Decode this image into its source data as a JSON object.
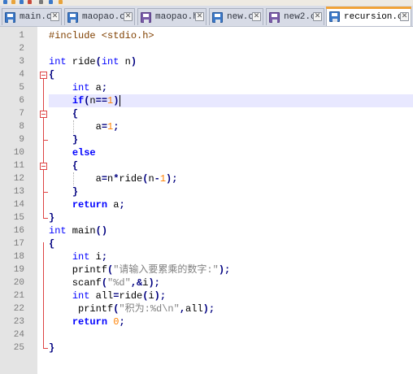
{
  "tabs": [
    {
      "label": "main.c",
      "icon": "save-icon",
      "color": "blue",
      "active": false
    },
    {
      "label": "maopao.c",
      "icon": "save-icon",
      "color": "blue",
      "active": false
    },
    {
      "label": "maopao.h",
      "icon": "save-icon",
      "color": "purple",
      "active": false
    },
    {
      "label": "new.c",
      "icon": "save-icon",
      "color": "blue",
      "active": false
    },
    {
      "label": "new2.c",
      "icon": "save-icon",
      "color": "purple",
      "active": false
    },
    {
      "label": "recursion.c",
      "icon": "save-icon",
      "color": "blue",
      "active": true
    }
  ],
  "close_symbol": "✕",
  "editor": {
    "current_line": 6,
    "lines": [
      {
        "n": "1",
        "tokens": [
          [
            "t-pre",
            "#include <stdio.h>"
          ]
        ]
      },
      {
        "n": "2",
        "tokens": []
      },
      {
        "n": "3",
        "tokens": [
          [
            "t-kw",
            "int"
          ],
          [
            "t-id",
            " ride"
          ],
          [
            "t-op",
            "("
          ],
          [
            "t-kw",
            "int"
          ],
          [
            "t-id",
            " n"
          ],
          [
            "t-op",
            ")"
          ]
        ]
      },
      {
        "n": "4",
        "tokens": [
          [
            "t-op",
            "{"
          ]
        ]
      },
      {
        "n": "5",
        "tokens": [
          [
            "t-id",
            "    "
          ],
          [
            "t-kw",
            "int"
          ],
          [
            "t-id",
            " a"
          ],
          [
            "t-op",
            ";"
          ]
        ]
      },
      {
        "n": "6",
        "tokens": [
          [
            "t-id",
            "    "
          ],
          [
            "t-kwb",
            "if"
          ],
          [
            "t-op",
            "("
          ],
          [
            "t-id",
            "n"
          ],
          [
            "t-op",
            "=="
          ],
          [
            "t-num",
            "1"
          ],
          [
            "t-op",
            ")"
          ]
        ]
      },
      {
        "n": "7",
        "tokens": [
          [
            "t-id",
            "    "
          ],
          [
            "t-op",
            "{"
          ]
        ]
      },
      {
        "n": "8",
        "tokens": [
          [
            "t-id",
            "        a"
          ],
          [
            "t-op",
            "="
          ],
          [
            "t-num",
            "1"
          ],
          [
            "t-op",
            ";"
          ]
        ]
      },
      {
        "n": "9",
        "tokens": [
          [
            "t-id",
            "    "
          ],
          [
            "t-op",
            "}"
          ]
        ]
      },
      {
        "n": "10",
        "tokens": [
          [
            "t-id",
            "    "
          ],
          [
            "t-kwb",
            "else"
          ]
        ]
      },
      {
        "n": "11",
        "tokens": [
          [
            "t-id",
            "    "
          ],
          [
            "t-op",
            "{"
          ]
        ]
      },
      {
        "n": "12",
        "tokens": [
          [
            "t-id",
            "        a"
          ],
          [
            "t-op",
            "="
          ],
          [
            "t-id",
            "n"
          ],
          [
            "t-op",
            "*"
          ],
          [
            "t-id",
            "ride"
          ],
          [
            "t-op",
            "("
          ],
          [
            "t-id",
            "n"
          ],
          [
            "t-op",
            "-"
          ],
          [
            "t-num",
            "1"
          ],
          [
            "t-op",
            ");"
          ]
        ]
      },
      {
        "n": "13",
        "tokens": [
          [
            "t-id",
            "    "
          ],
          [
            "t-op",
            "}"
          ]
        ]
      },
      {
        "n": "14",
        "tokens": [
          [
            "t-id",
            "    "
          ],
          [
            "t-kwb",
            "return"
          ],
          [
            "t-id",
            " a"
          ],
          [
            "t-op",
            ";"
          ]
        ]
      },
      {
        "n": "15",
        "tokens": [
          [
            "t-op",
            "}"
          ]
        ]
      },
      {
        "n": "16",
        "tokens": [
          [
            "t-kw",
            "int"
          ],
          [
            "t-id",
            " main"
          ],
          [
            "t-op",
            "()"
          ]
        ]
      },
      {
        "n": "17",
        "tokens": [
          [
            "t-op",
            "{"
          ]
        ]
      },
      {
        "n": "18",
        "tokens": [
          [
            "t-id",
            "    "
          ],
          [
            "t-kw",
            "int"
          ],
          [
            "t-id",
            " i"
          ],
          [
            "t-op",
            ";"
          ]
        ]
      },
      {
        "n": "19",
        "tokens": [
          [
            "t-id",
            "    printf"
          ],
          [
            "t-op",
            "("
          ],
          [
            "t-str",
            "\"请输入要累乘的数字:\""
          ],
          [
            "t-op",
            ");"
          ]
        ]
      },
      {
        "n": "20",
        "tokens": [
          [
            "t-id",
            "    scanf"
          ],
          [
            "t-op",
            "("
          ],
          [
            "t-str",
            "\"%d\""
          ],
          [
            "t-op",
            ",&"
          ],
          [
            "t-id",
            "i"
          ],
          [
            "t-op",
            ");"
          ]
        ]
      },
      {
        "n": "21",
        "tokens": [
          [
            "t-id",
            "    "
          ],
          [
            "t-kw",
            "int"
          ],
          [
            "t-id",
            " all"
          ],
          [
            "t-op",
            "="
          ],
          [
            "t-id",
            "ride"
          ],
          [
            "t-op",
            "("
          ],
          [
            "t-id",
            "i"
          ],
          [
            "t-op",
            ");"
          ]
        ]
      },
      {
        "n": "22",
        "tokens": [
          [
            "t-id",
            "     printf"
          ],
          [
            "t-op",
            "("
          ],
          [
            "t-str",
            "\"积为:%d\\n\""
          ],
          [
            "t-op",
            ","
          ],
          [
            "t-id",
            "all"
          ],
          [
            "t-op",
            ");"
          ]
        ]
      },
      {
        "n": "23",
        "tokens": [
          [
            "t-id",
            "    "
          ],
          [
            "t-kwb",
            "return"
          ],
          [
            "t-id",
            " "
          ],
          [
            "t-num",
            "0"
          ],
          [
            "t-op",
            ";"
          ]
        ]
      },
      {
        "n": "24",
        "tokens": []
      },
      {
        "n": "25",
        "tokens": [
          [
            "t-op",
            "}"
          ]
        ]
      }
    ]
  }
}
